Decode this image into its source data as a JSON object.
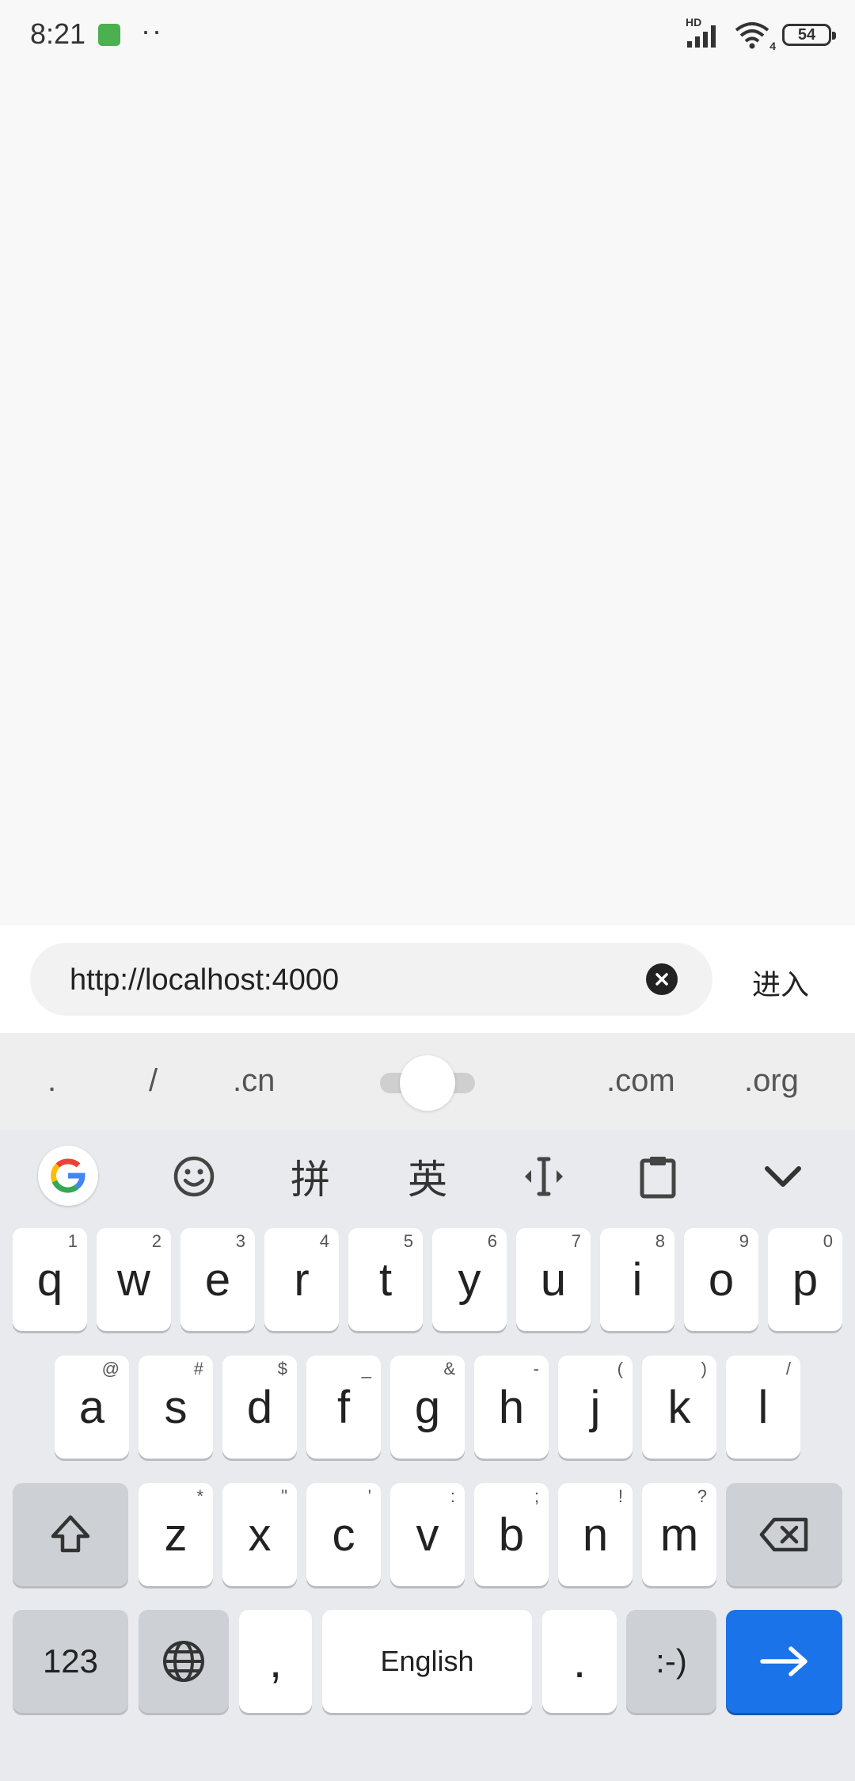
{
  "status_bar": {
    "time": "8:21",
    "dots": "··",
    "network_label": "HD",
    "signal_gen": "4",
    "battery": "54"
  },
  "url_bar": {
    "value": "http://localhost:4000",
    "enter_label": "进入"
  },
  "suggestions": {
    "left": [
      ".",
      "/",
      ".cn"
    ],
    "right": [
      ".com",
      ".org"
    ]
  },
  "keyboard_toolbar": {
    "pinyin_label": "拼",
    "english_label": "英"
  },
  "keys": {
    "row1": [
      {
        "char": "q",
        "sup": "1"
      },
      {
        "char": "w",
        "sup": "2"
      },
      {
        "char": "e",
        "sup": "3"
      },
      {
        "char": "r",
        "sup": "4"
      },
      {
        "char": "t",
        "sup": "5"
      },
      {
        "char": "y",
        "sup": "6"
      },
      {
        "char": "u",
        "sup": "7"
      },
      {
        "char": "i",
        "sup": "8"
      },
      {
        "char": "o",
        "sup": "9"
      },
      {
        "char": "p",
        "sup": "0"
      }
    ],
    "row2": [
      {
        "char": "a",
        "sup": "@"
      },
      {
        "char": "s",
        "sup": "#"
      },
      {
        "char": "d",
        "sup": "$"
      },
      {
        "char": "f",
        "sup": "_"
      },
      {
        "char": "g",
        "sup": "&"
      },
      {
        "char": "h",
        "sup": "-"
      },
      {
        "char": "j",
        "sup": "("
      },
      {
        "char": "k",
        "sup": ")"
      },
      {
        "char": "l",
        "sup": "/"
      }
    ],
    "row3": [
      {
        "char": "z",
        "sup": "*"
      },
      {
        "char": "x",
        "sup": "\""
      },
      {
        "char": "c",
        "sup": "'"
      },
      {
        "char": "v",
        "sup": ":"
      },
      {
        "char": "b",
        "sup": ";"
      },
      {
        "char": "n",
        "sup": "!"
      },
      {
        "char": "m",
        "sup": "?"
      }
    ],
    "bottom": {
      "numbers": "123",
      "comma": ",",
      "space": "English",
      "period": ".",
      "emoticon": ":-)"
    }
  },
  "colors": {
    "enter_key": "#1a73e8",
    "keyboard_bg": "#e8eaed"
  }
}
